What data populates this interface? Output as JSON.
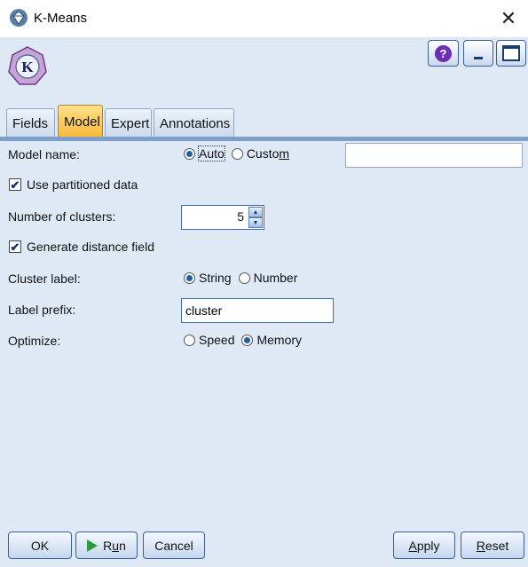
{
  "window": {
    "title": "K-Means",
    "close_glyph": "✕"
  },
  "header": {
    "node_icon": "kmeans-node-icon",
    "node_letter": "K",
    "help_glyph": "?"
  },
  "tabs": [
    {
      "label": "Fields",
      "active": false
    },
    {
      "label": "Model",
      "active": true
    },
    {
      "label": "Expert",
      "active": false
    },
    {
      "label": "Annotations",
      "active": false
    }
  ],
  "form": {
    "model_name": {
      "label": "Model name:",
      "options": [
        "Auto",
        "Custom"
      ],
      "selected": "Auto",
      "custom_value": ""
    },
    "use_partitioned": {
      "label": "Use partitioned data",
      "checked": true
    },
    "num_clusters": {
      "label": "Number of clusters:",
      "value": "5"
    },
    "generate_distance": {
      "label": "Generate distance field",
      "checked": true
    },
    "cluster_label": {
      "label": "Cluster label:",
      "options": [
        "String",
        "Number"
      ],
      "selected": "String"
    },
    "label_prefix": {
      "label": "Label prefix:",
      "value": "cluster"
    },
    "optimize": {
      "label": "Optimize:",
      "options": [
        "Speed",
        "Memory"
      ],
      "selected": "Memory"
    }
  },
  "footer": {
    "ok": "OK",
    "run": "Run",
    "cancel": "Cancel",
    "apply": "Apply",
    "reset": "Reset"
  },
  "colors": {
    "accent_tab": "#f5b838",
    "panel_bg": "#dfe9f5",
    "divider": "#7f9fcb"
  }
}
